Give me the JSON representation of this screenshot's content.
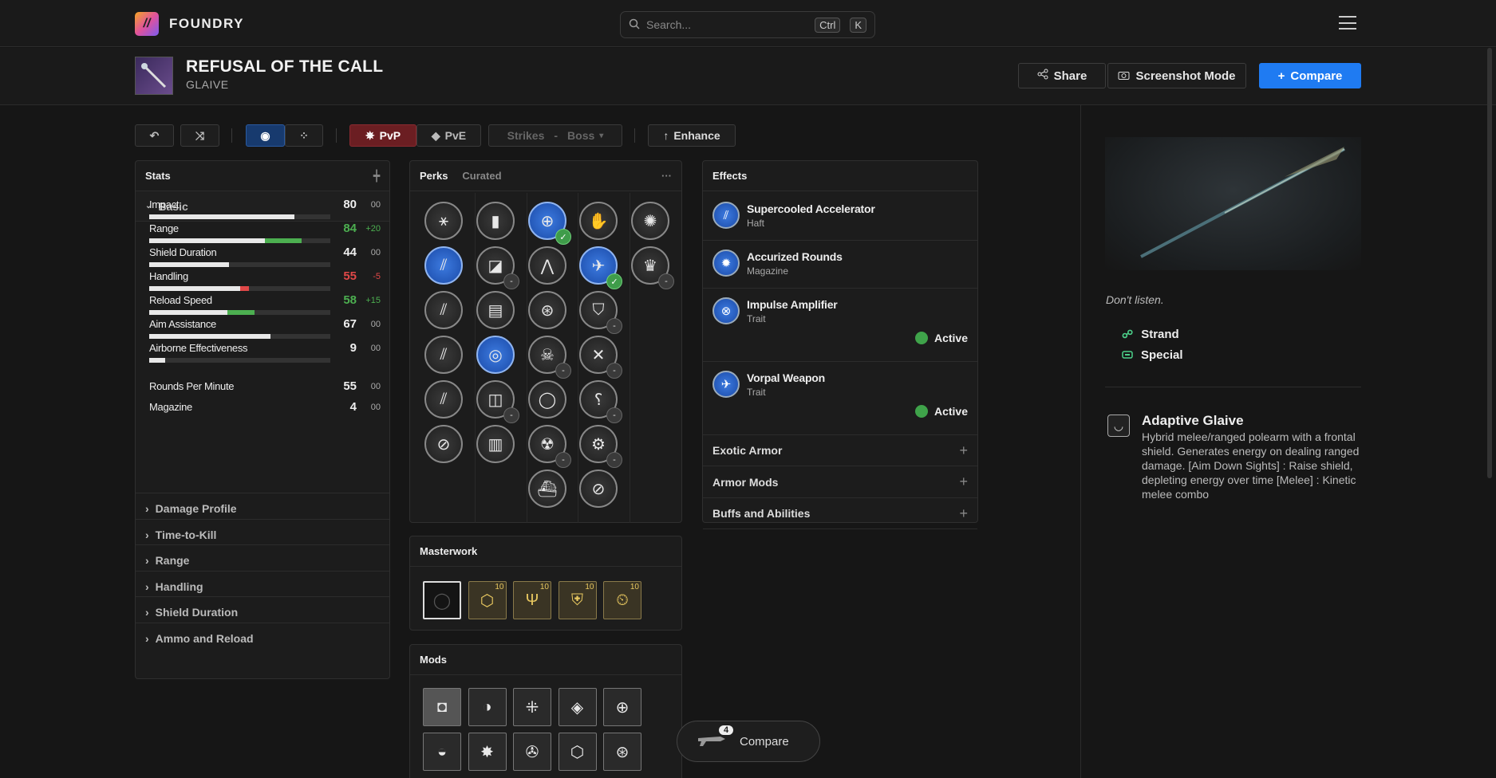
{
  "app": {
    "brand": "FOUNDRY",
    "logo_glyph": "//"
  },
  "search": {
    "placeholder": "Search...",
    "kbd1": "Ctrl",
    "kbd2": "K"
  },
  "weapon": {
    "name": "REFUSAL OF THE CALL",
    "type": "GLAIVE"
  },
  "header_buttons": {
    "share": "Share",
    "screenshot": "Screenshot Mode",
    "compare": "Compare"
  },
  "toolbar": {
    "pvp": "PvP",
    "pve": "PvE",
    "strikes": "Strikes",
    "dash": "-",
    "boss": "Boss",
    "enhance": "Enhance"
  },
  "stats": {
    "title": "Stats",
    "group": "Basic",
    "items": [
      {
        "name": "Impact",
        "value": "80",
        "delta": "00",
        "base": 80,
        "bonus": 0
      },
      {
        "name": "Range",
        "value": "84",
        "delta": "+20",
        "base": 64,
        "bonus": 20
      },
      {
        "name": "Shield Duration",
        "value": "44",
        "delta": "00",
        "base": 44,
        "bonus": 0
      },
      {
        "name": "Handling",
        "value": "55",
        "delta": "-5",
        "base": 55,
        "bonus": -5
      },
      {
        "name": "Reload Speed",
        "value": "58",
        "delta": "+15",
        "base": 43,
        "bonus": 15
      },
      {
        "name": "Aim Assistance",
        "value": "67",
        "delta": "00",
        "base": 67,
        "bonus": 0
      },
      {
        "name": "Airborne Effectiveness",
        "value": "9",
        "delta": "00",
        "base": 9,
        "bonus": 0
      }
    ],
    "plain": [
      {
        "name": "Rounds Per Minute",
        "value": "55",
        "delta": "00"
      },
      {
        "name": "Magazine",
        "value": "4",
        "delta": "00"
      }
    ],
    "sections": [
      "Damage Profile",
      "Time-to-Kill",
      "Range",
      "Handling",
      "Shield Duration",
      "Ammo and Reload"
    ]
  },
  "perks": {
    "title": "Perks",
    "tab": "Curated",
    "more": "···"
  },
  "masterwork": {
    "title": "Masterwork",
    "level": "10"
  },
  "mods": {
    "title": "Mods"
  },
  "effects": {
    "title": "Effects",
    "items": [
      {
        "name": "Supercooled Accelerator",
        "sub": "Haft"
      },
      {
        "name": "Accurized Rounds",
        "sub": "Magazine"
      },
      {
        "name": "Impulse Amplifier",
        "sub": "Trait",
        "status": "Active"
      },
      {
        "name": "Vorpal Weapon",
        "sub": "Trait",
        "status": "Active"
      }
    ],
    "sections": [
      "Exotic Armor",
      "Armor Mods",
      "Buffs and Abilities"
    ]
  },
  "details": {
    "flavor": "Don't listen.",
    "element": "Strand",
    "ammo": "Special",
    "frame_name": "Adaptive Glaive",
    "frame_desc": "Hybrid melee/ranged polearm with a frontal shield. Generates energy on dealing ranged damage. [Aim Down Sights] : Raise shield, depleting energy over time [Melee] : Kinetic melee combo"
  },
  "compare_pill": {
    "label": "Compare",
    "count": "4"
  },
  "colors": {
    "accent": "#1f7bf2",
    "pvp": "#6b1e22",
    "positive": "#4caf50",
    "negative": "#e04848",
    "active": "#3fa34a"
  }
}
